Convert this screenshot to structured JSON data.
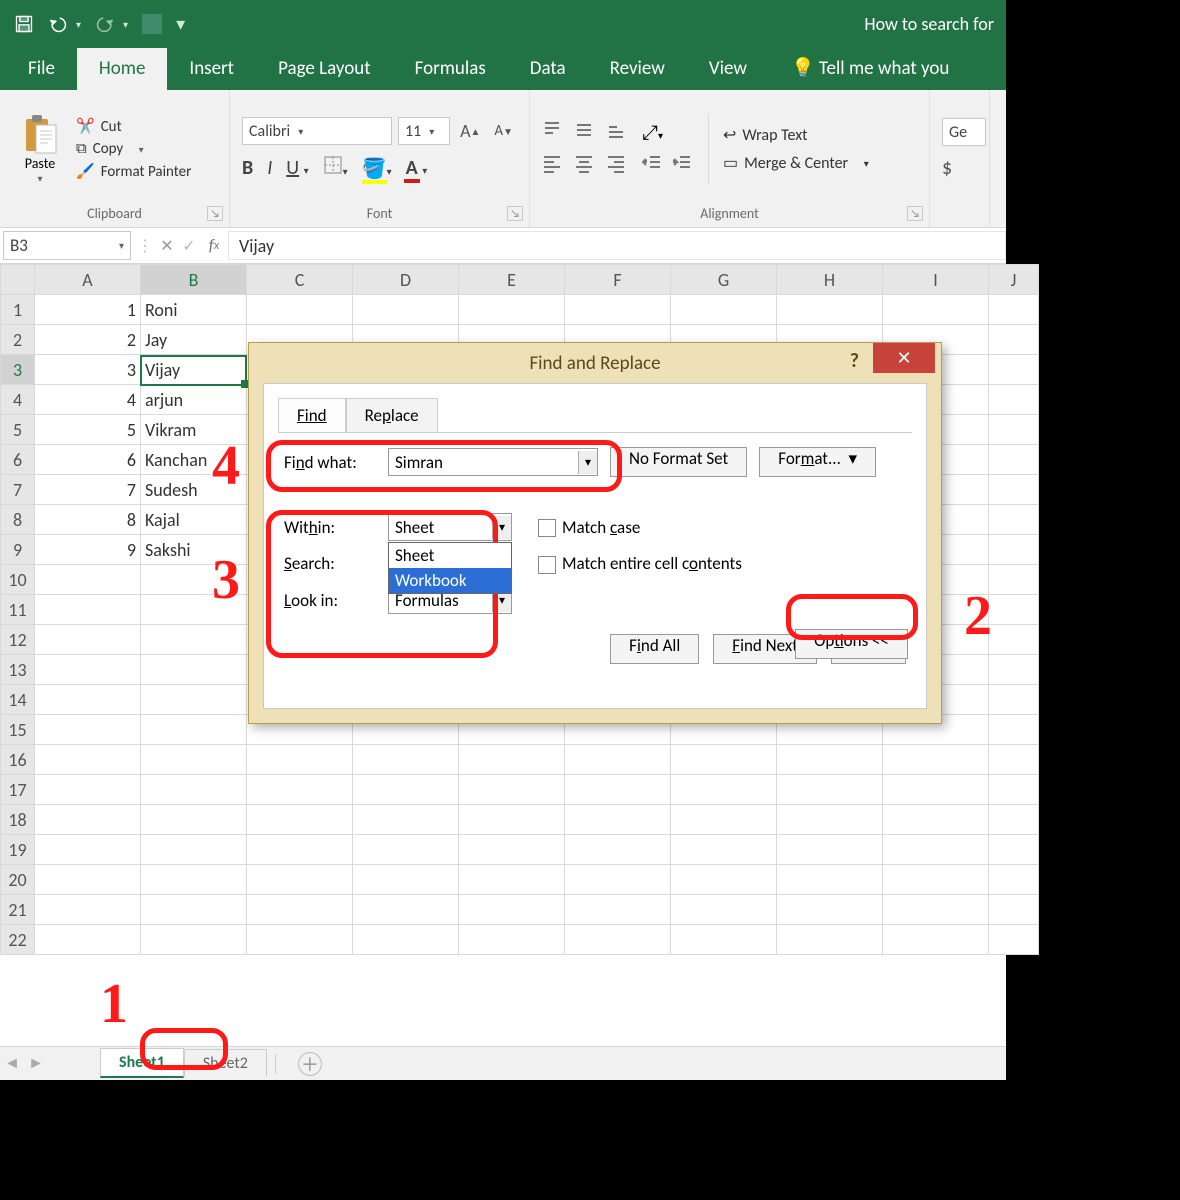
{
  "titlebar": {
    "doc": "How to search for"
  },
  "ribbon": {
    "tabs": [
      "File",
      "Home",
      "Insert",
      "Page Layout",
      "Formulas",
      "Data",
      "Review",
      "View"
    ],
    "tell_me": "Tell me what you",
    "clipboard": {
      "paste": "Paste",
      "cut": "Cut",
      "copy": "Copy",
      "fmtpaint": "Format Painter",
      "label": "Clipboard"
    },
    "font": {
      "name": "Calibri",
      "size": "11",
      "label": "Font"
    },
    "alignment": {
      "wrap": "Wrap Text",
      "merge": "Merge & Center",
      "label": "Alignment"
    },
    "number": {
      "fmt": "Ge",
      "dollar": "$"
    }
  },
  "fbar": {
    "name": "B3",
    "fx": "Vijay"
  },
  "grid": {
    "cols": [
      "A",
      "B",
      "C",
      "D",
      "E",
      "F",
      "G",
      "H",
      "I",
      "J"
    ],
    "rows": [
      {
        "n": "1",
        "a": "1",
        "b": "Roni"
      },
      {
        "n": "2",
        "a": "2",
        "b": "Jay"
      },
      {
        "n": "3",
        "a": "3",
        "b": "Vijay"
      },
      {
        "n": "4",
        "a": "4",
        "b": "arjun"
      },
      {
        "n": "5",
        "a": "5",
        "b": "Vikram"
      },
      {
        "n": "6",
        "a": "6",
        "b": "Kanchan"
      },
      {
        "n": "7",
        "a": "7",
        "b": "Sudesh"
      },
      {
        "n": "8",
        "a": "8",
        "b": "Kajal"
      },
      {
        "n": "9",
        "a": "9",
        "b": "Sakshi"
      },
      {
        "n": "10"
      },
      {
        "n": "11"
      },
      {
        "n": "12"
      },
      {
        "n": "13"
      },
      {
        "n": "14"
      },
      {
        "n": "15"
      },
      {
        "n": "16"
      },
      {
        "n": "17"
      },
      {
        "n": "18"
      },
      {
        "n": "19"
      },
      {
        "n": "20"
      },
      {
        "n": "21"
      },
      {
        "n": "22"
      }
    ],
    "selected": {
      "col": "B",
      "row": "3"
    }
  },
  "dialog": {
    "title": "Find and Replace",
    "tabs": {
      "find": "Find",
      "replace": "Replace"
    },
    "find_what_label": "Find what:",
    "find_what_value": "Simran",
    "no_format": "No Format Set",
    "format": "Format...",
    "within_label": "Within:",
    "within_value": "Sheet",
    "within_options": [
      "Sheet",
      "Workbook"
    ],
    "search_label": "Search:",
    "lookin_label": "Look in:",
    "lookin_value": "Formulas",
    "match_case": "Match case",
    "match_entire": "Match entire cell contents",
    "options": "Options <<",
    "find_all": "Find All",
    "find_next": "Find Next",
    "close": "Close"
  },
  "sheets": {
    "s1": "Sheet1",
    "s2": "Sheet2"
  },
  "annotations": {
    "n1": "1",
    "n2": "2",
    "n3": "3",
    "n4": "4"
  }
}
